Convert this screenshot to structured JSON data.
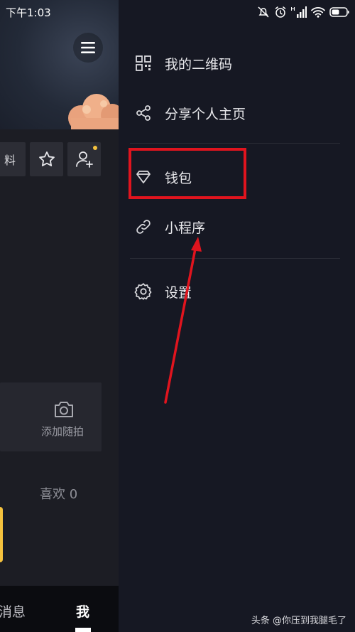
{
  "status_bar": {
    "time": "下午1:03"
  },
  "profile": {
    "edit_label": "料",
    "capture_label": "添加随拍",
    "likes_label": "喜欢 0"
  },
  "bottom_nav": {
    "messages": "消息",
    "me": "我"
  },
  "drawer": {
    "items": [
      {
        "label": "我的二维码",
        "icon": "qr-code-icon"
      },
      {
        "label": "分享个人主页",
        "icon": "share-icon"
      },
      {
        "label": "钱包",
        "icon": "diamond-icon"
      },
      {
        "label": "小程序",
        "icon": "link-icon"
      },
      {
        "label": "设置",
        "icon": "gear-icon"
      }
    ]
  },
  "annotation": {
    "highlight_color": "#e0141e"
  },
  "watermark": "头条 @你压到我腿毛了"
}
